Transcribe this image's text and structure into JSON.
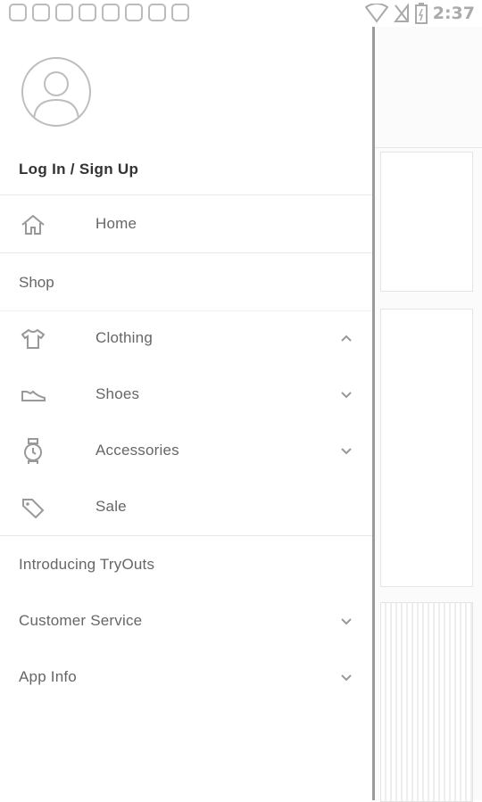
{
  "status_bar": {
    "time": "2:37"
  },
  "drawer": {
    "login_label": "Log In / Sign Up",
    "home_label": "Home",
    "shop_heading": "Shop",
    "shop_items": [
      {
        "label": "Clothing",
        "icon": "shirt-icon",
        "expanded": true
      },
      {
        "label": "Shoes",
        "icon": "shoe-icon",
        "expanded": false
      },
      {
        "label": "Accessories",
        "icon": "watch-icon",
        "expanded": false
      },
      {
        "label": "Sale",
        "icon": "tag-icon"
      }
    ],
    "bottom_items": [
      {
        "label": "Introducing TryOuts"
      },
      {
        "label": "Customer Service",
        "expandable": true
      },
      {
        "label": "App Info",
        "expandable": true
      }
    ]
  }
}
